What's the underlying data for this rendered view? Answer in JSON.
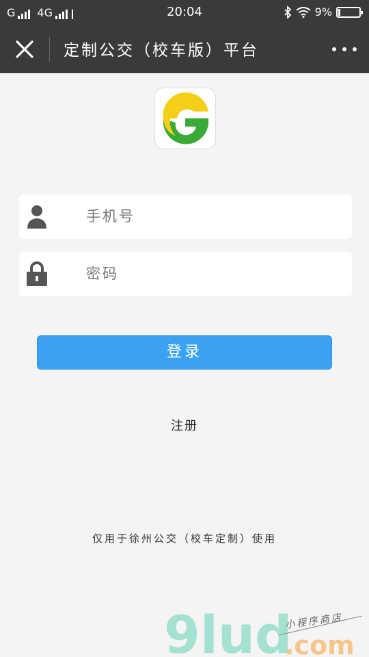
{
  "status_bar": {
    "carrier1": "G",
    "network": "4G",
    "time": "20:04",
    "battery": "9%",
    "battery_level": 0.09
  },
  "nav": {
    "title": "定制公交（校车版）平台",
    "close_icon": "close-icon",
    "more_icon": "more-dots-icon"
  },
  "form": {
    "phone_placeholder": "手机号",
    "password_placeholder": "密码",
    "login_label": "登录",
    "register_label": "注册"
  },
  "footer": {
    "notice": "仅用于徐州公交（校车定制）使用"
  },
  "watermark": {
    "brand": "9lud",
    "suffix": ".com",
    "tagline": "小程序商店"
  },
  "colors": {
    "topbar": "#3a3a3a",
    "primary": "#3ba2f3",
    "logo_yellow": "#f4cf1a",
    "logo_green": "#3aa935"
  }
}
